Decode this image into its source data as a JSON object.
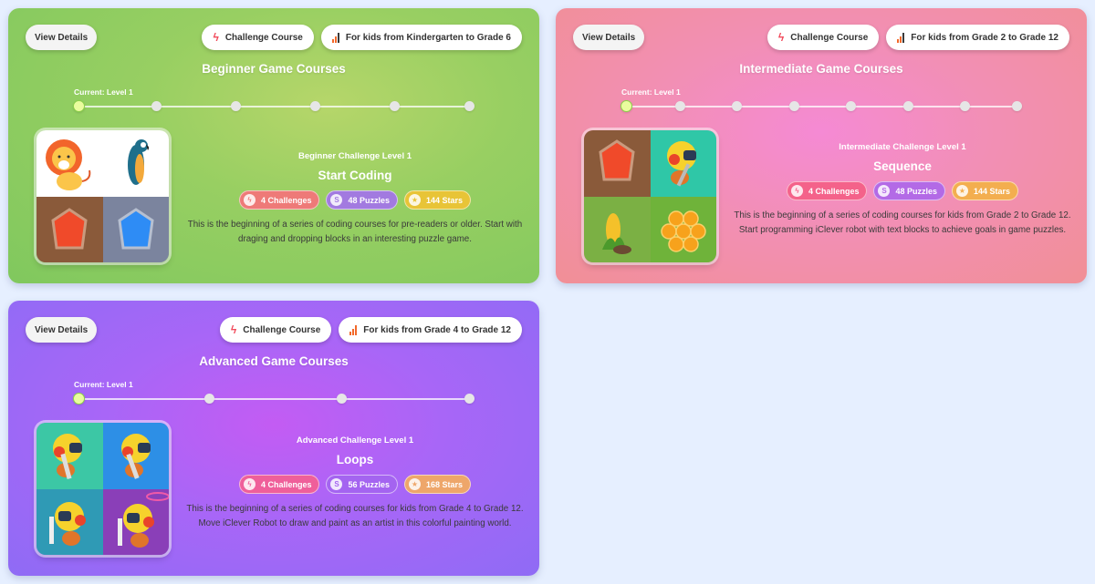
{
  "common": {
    "view_details_label": "View Details",
    "challenge_course_label": "Challenge Course"
  },
  "courses": [
    {
      "key": "beginner",
      "title": "Beginner Game Courses",
      "age_range": "For kids from Kindergarten to Grade 6",
      "current_level_label": "Current: Level 1",
      "level_count": 6,
      "current_level": 1,
      "challenge": {
        "subtitle": "Beginner Challenge Level 1",
        "name": "Start Coding",
        "challenges": "4 Challenges",
        "puzzles": "48 Puzzles",
        "stars": "144 Stars",
        "description": "This is the beginning of a series of coding courses for pre-readers or older. Start with draging and dropping blocks in an interesting puzzle game."
      },
      "thumbnail_tiles": [
        "lion",
        "parrot",
        "red-gem",
        "blue-gem"
      ],
      "colors": {
        "challenges": "#ee7a78",
        "puzzles": "#a27ae0",
        "stars": "#e8c437"
      }
    },
    {
      "key": "intermediate",
      "title": "Intermediate Game Courses",
      "age_range": "For kids from Grade 2 to Grade 12",
      "current_level_label": "Current: Level 1",
      "level_count": 8,
      "current_level": 1,
      "challenge": {
        "subtitle": "Intermediate Challenge Level 1",
        "name": "Sequence",
        "challenges": "4 Challenges",
        "puzzles": "48 Puzzles",
        "stars": "144 Stars",
        "description": "This is the beginning of a series of coding courses for kids from Grade 2 to Grade 12. Start programming iClever robot with text blocks to achieve goals in game puzzles."
      },
      "thumbnail_tiles": [
        "red-gem",
        "robot",
        "corn",
        "honeycomb"
      ],
      "colors": {
        "challenges": "#f4628a",
        "puzzles": "#b36ae6",
        "stars": "#f3ae4f"
      }
    },
    {
      "key": "advanced",
      "title": "Advanced Game Courses",
      "age_range": "For kids from Grade 4 to Grade 12",
      "current_level_label": "Current: Level 1",
      "level_count": 4,
      "current_level": 1,
      "challenge": {
        "subtitle": "Advanced Challenge Level 1",
        "name": "Loops",
        "challenges": "4 Challenges",
        "puzzles": "56 Puzzles",
        "stars": "168 Stars",
        "description": "This is the beginning of a series of coding courses for kids from Grade 4 to Grade 12. Move iClever Robot to draw and paint as an artist in this colorful painting world."
      },
      "thumbnail_tiles": [
        "robot-painter-green",
        "robot-painter-blue",
        "robot-painter-teal",
        "robot-painter-purple"
      ],
      "colors": {
        "challenges": "#ef5f9a",
        "puzzles": "#a464f0",
        "stars": "#eea66a"
      }
    }
  ]
}
